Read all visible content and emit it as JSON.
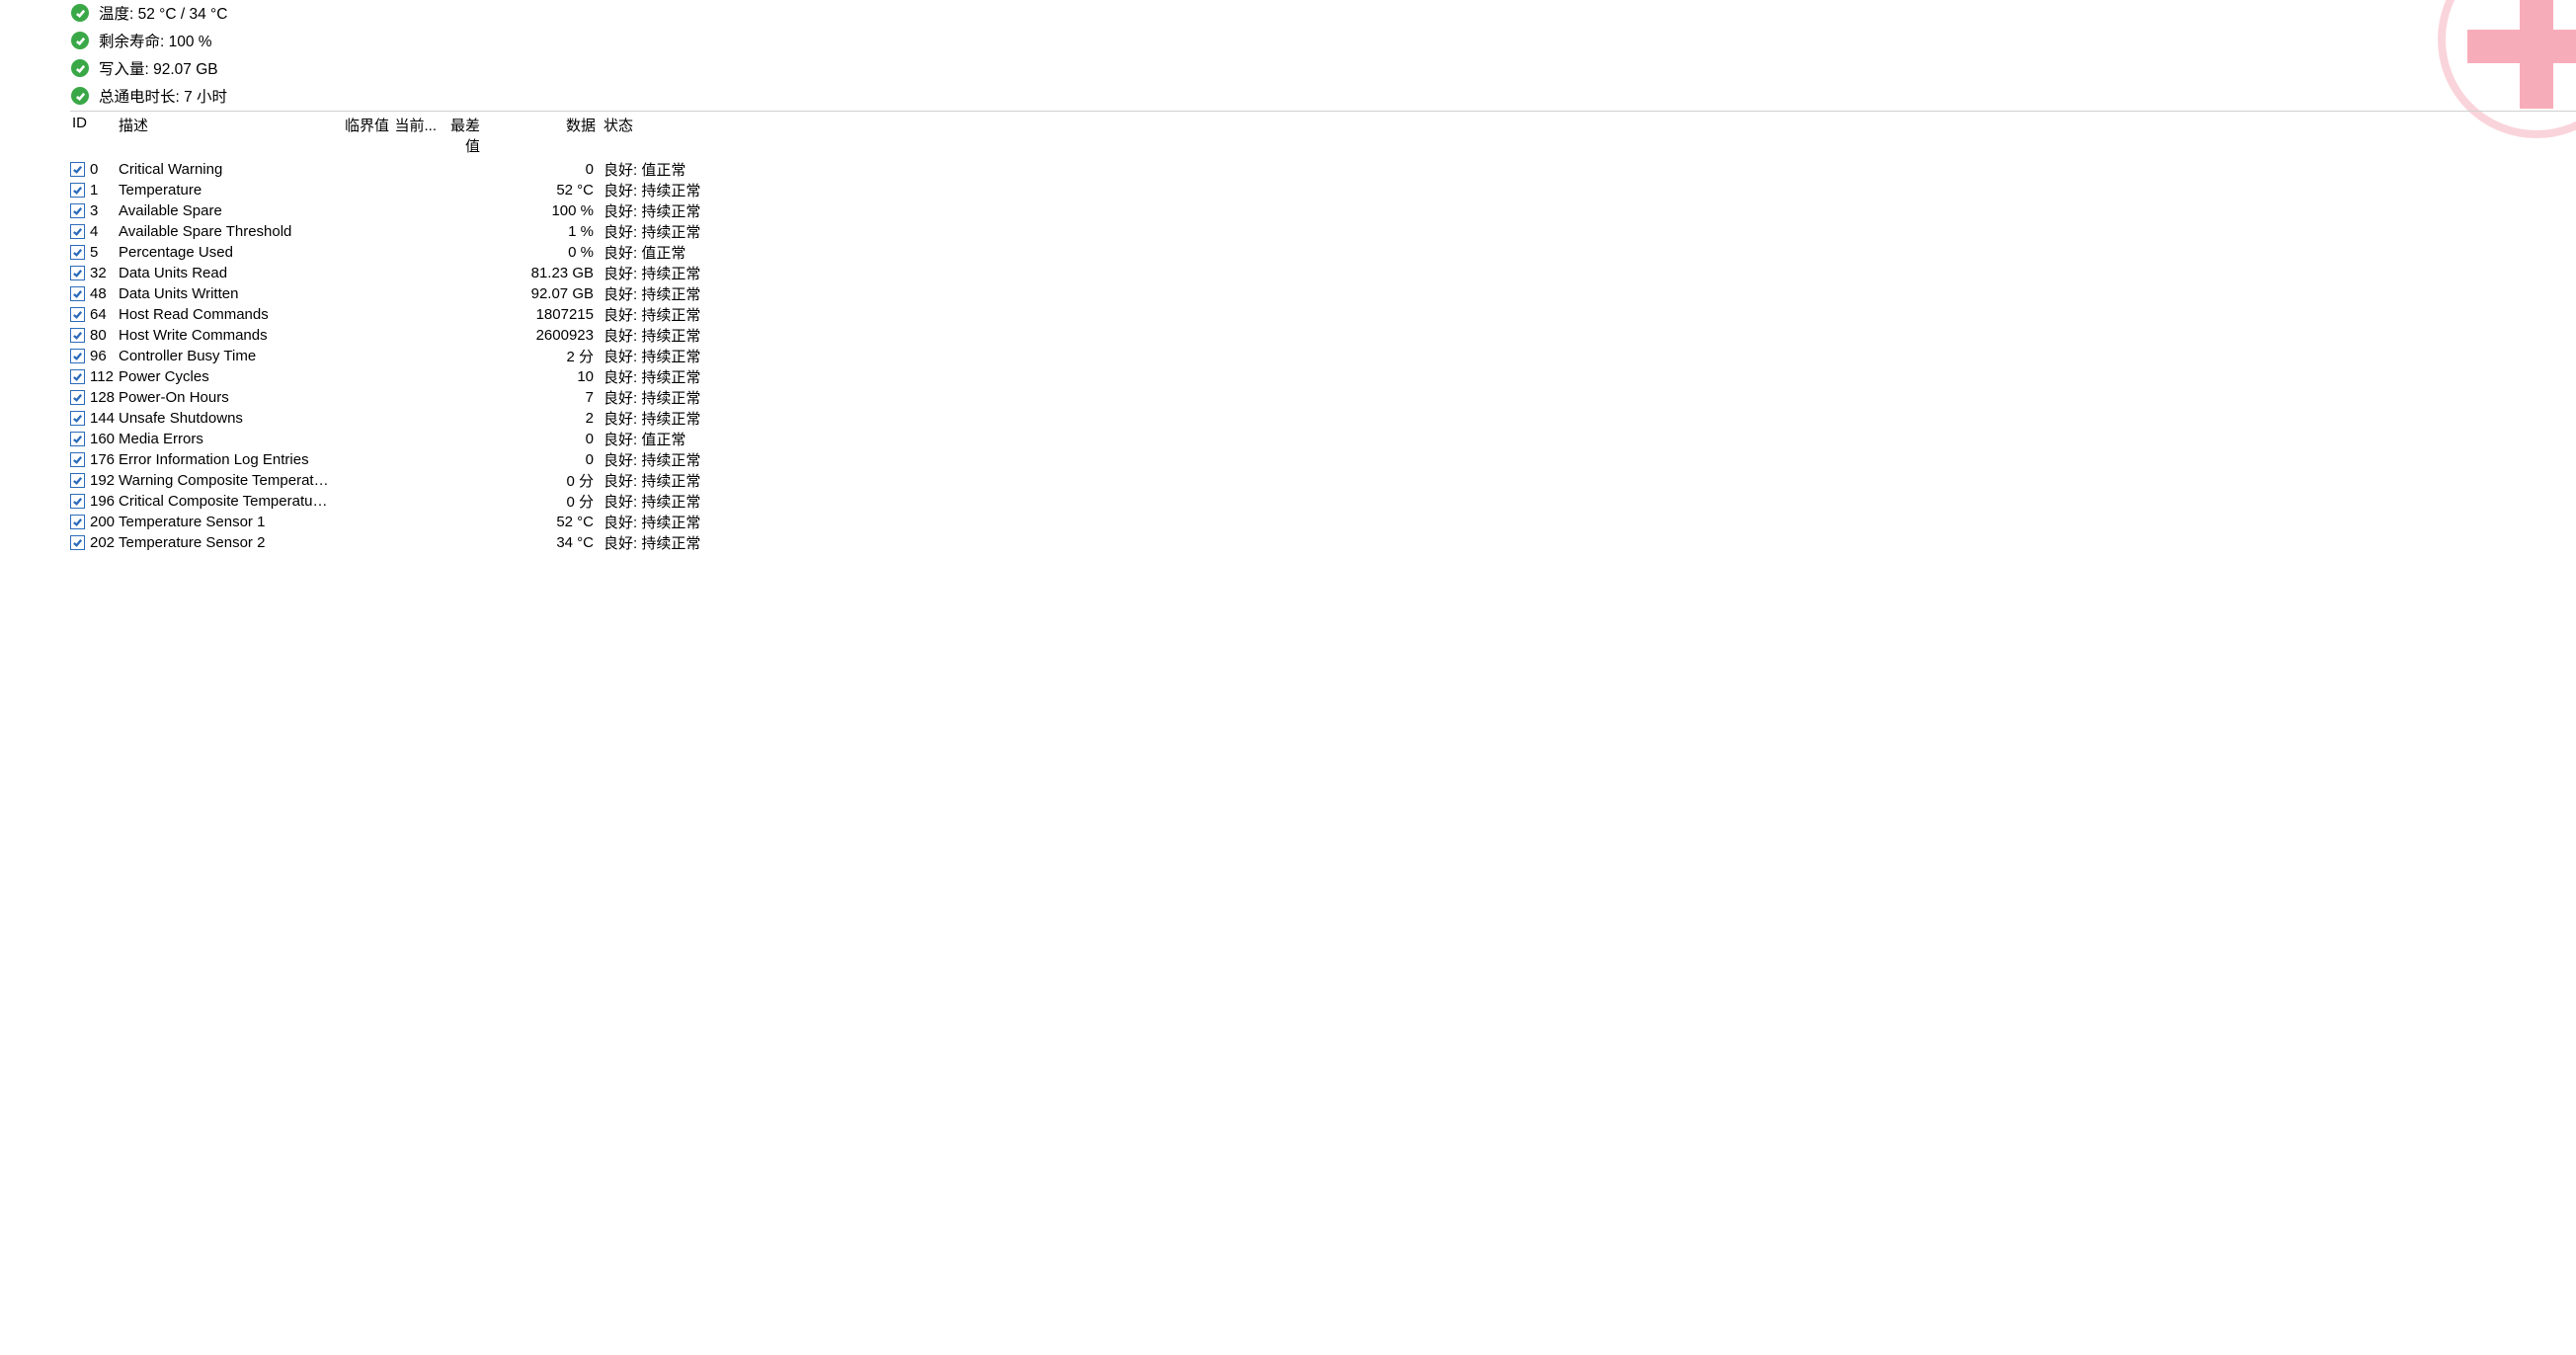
{
  "status": [
    {
      "label": "温度: 52 °C / 34 °C"
    },
    {
      "label": "剩余寿命: 100 %"
    },
    {
      "label": "写入量: 92.07 GB"
    },
    {
      "label": "总通电时长: 7 小时"
    }
  ],
  "columns": {
    "id": "ID",
    "desc": "描述",
    "threshold": "临界值",
    "current": "当前...",
    "worst": "最差值",
    "data": "数据",
    "status": "状态"
  },
  "rows": [
    {
      "id": "0",
      "desc": "Critical Warning",
      "data": "0",
      "status": "良好:  值正常"
    },
    {
      "id": "1",
      "desc": "Temperature",
      "data": "52 °C",
      "status": "良好:  持续正常"
    },
    {
      "id": "3",
      "desc": "Available Spare",
      "data": "100 %",
      "status": "良好:  持续正常"
    },
    {
      "id": "4",
      "desc": "Available Spare Threshold",
      "data": "1 %",
      "status": "良好:  持续正常"
    },
    {
      "id": "5",
      "desc": "Percentage Used",
      "data": "0 %",
      "status": "良好:  值正常"
    },
    {
      "id": "32",
      "desc": "Data Units Read",
      "data": "81.23 GB",
      "status": "良好:  持续正常"
    },
    {
      "id": "48",
      "desc": "Data Units Written",
      "data": "92.07 GB",
      "status": "良好:  持续正常"
    },
    {
      "id": "64",
      "desc": "Host Read Commands",
      "data": "1807215",
      "status": "良好:  持续正常"
    },
    {
      "id": "80",
      "desc": "Host Write Commands",
      "data": "2600923",
      "status": "良好:  持续正常"
    },
    {
      "id": "96",
      "desc": "Controller Busy Time",
      "data": "2 分",
      "status": "良好:  持续正常"
    },
    {
      "id": "112",
      "desc": "Power Cycles",
      "data": "10",
      "status": "良好:  持续正常"
    },
    {
      "id": "128",
      "desc": "Power-On Hours",
      "data": "7",
      "status": "良好:  持续正常"
    },
    {
      "id": "144",
      "desc": "Unsafe Shutdowns",
      "data": "2",
      "status": "良好:  持续正常"
    },
    {
      "id": "160",
      "desc": "Media Errors",
      "data": "0",
      "status": "良好:  值正常"
    },
    {
      "id": "176",
      "desc": "Error Information Log Entries",
      "data": "0",
      "status": "良好:  持续正常"
    },
    {
      "id": "192",
      "desc": "Warning Composite Temperatur...",
      "data": "0 分",
      "status": "良好:  持续正常"
    },
    {
      "id": "196",
      "desc": "Critical Composite Temperature ...",
      "data": "0 分",
      "status": "良好:  持续正常"
    },
    {
      "id": "200",
      "desc": "Temperature Sensor 1",
      "data": "52 °C",
      "status": "良好:  持续正常"
    },
    {
      "id": "202",
      "desc": "Temperature Sensor 2",
      "data": "34 °C",
      "status": "良好:  持续正常"
    }
  ]
}
